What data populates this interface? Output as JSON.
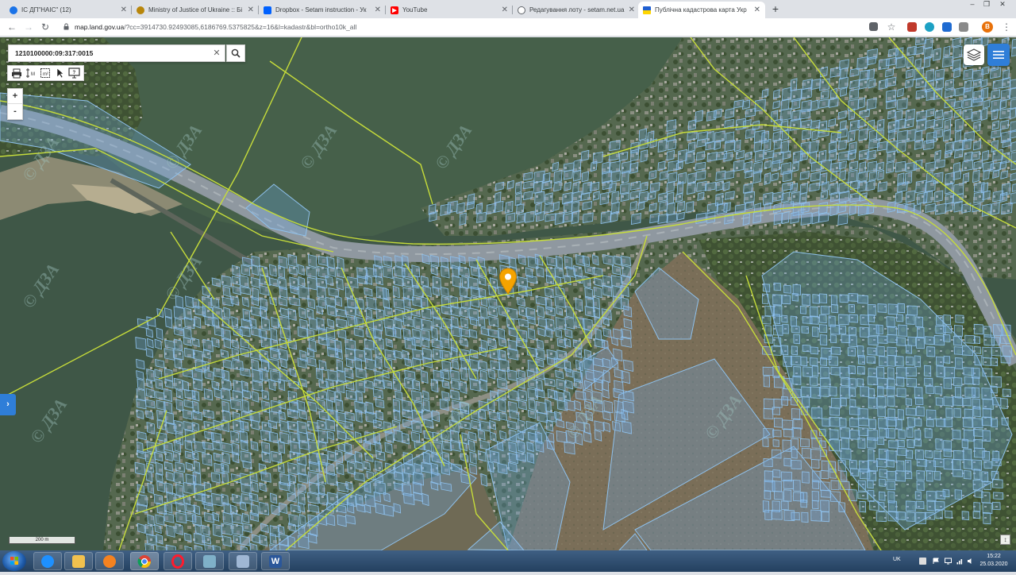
{
  "browser": {
    "tabs": [
      {
        "title": "ІС ДП\"НАІС\" (12)",
        "favicon_color": "#1a73e8",
        "active": false
      },
      {
        "title": "Ministry of Justice of Ukraine :: Бі",
        "favicon_color": "#b8860b",
        "active": false
      },
      {
        "title": "Dropbox - Setam instruction - Ук",
        "favicon_color": "#0061fe",
        "active": false
      },
      {
        "title": "YouTube",
        "favicon_color": "#ff0000",
        "active": false
      },
      {
        "title": "Редагування лоту - setam.net.ua",
        "favicon_color": "#5f6368",
        "active": false
      },
      {
        "title": "Публічна кадастрова карта Укр",
        "favicon_color": "#ffd500",
        "active": true
      }
    ],
    "new_tab_symbol": "+",
    "window_controls": [
      "–",
      "❐",
      "✕"
    ],
    "url": {
      "host": "map.land.gov.ua",
      "rest": "/?cc=3914730.92493085,6186769.5375825&z=16&l=kadastr&bl=ortho10k_all"
    },
    "profile_initial": "B"
  },
  "map": {
    "search": {
      "value": "1210100000:09:317:0015",
      "clear_symbol": "✕"
    },
    "zoom": {
      "in": "+",
      "out": "-"
    },
    "side_toggle_symbol": "›",
    "scale_label": "200 m",
    "info_symbol": "↕",
    "watermark_text": "© ДЗА",
    "colors": {
      "parcel_stroke": "#8fc1ec",
      "parcel_fill": "rgba(110,170,230,0.30)",
      "boundary_green": "#c6dc3a",
      "marker": "#f5a300",
      "water": "#405848",
      "urban": "#566b52"
    }
  },
  "taskbar": {
    "language": "UK",
    "time": "15:22",
    "date": "25.03.2020",
    "apps": [
      {
        "name": "internet-explorer-icon",
        "color": "#1e90ff"
      },
      {
        "name": "file-explorer-icon",
        "color": "#f2c14e"
      },
      {
        "name": "media-player-icon",
        "color": "#f58220"
      },
      {
        "name": "chrome-icon",
        "color": "#34a853"
      },
      {
        "name": "opera-icon",
        "color": "#ff1b2d"
      },
      {
        "name": "app-icon",
        "color": "#7fb0c8"
      },
      {
        "name": "notepad-icon",
        "color": "#9fb7d4"
      },
      {
        "name": "word-icon",
        "color": "#2b579a"
      }
    ]
  }
}
